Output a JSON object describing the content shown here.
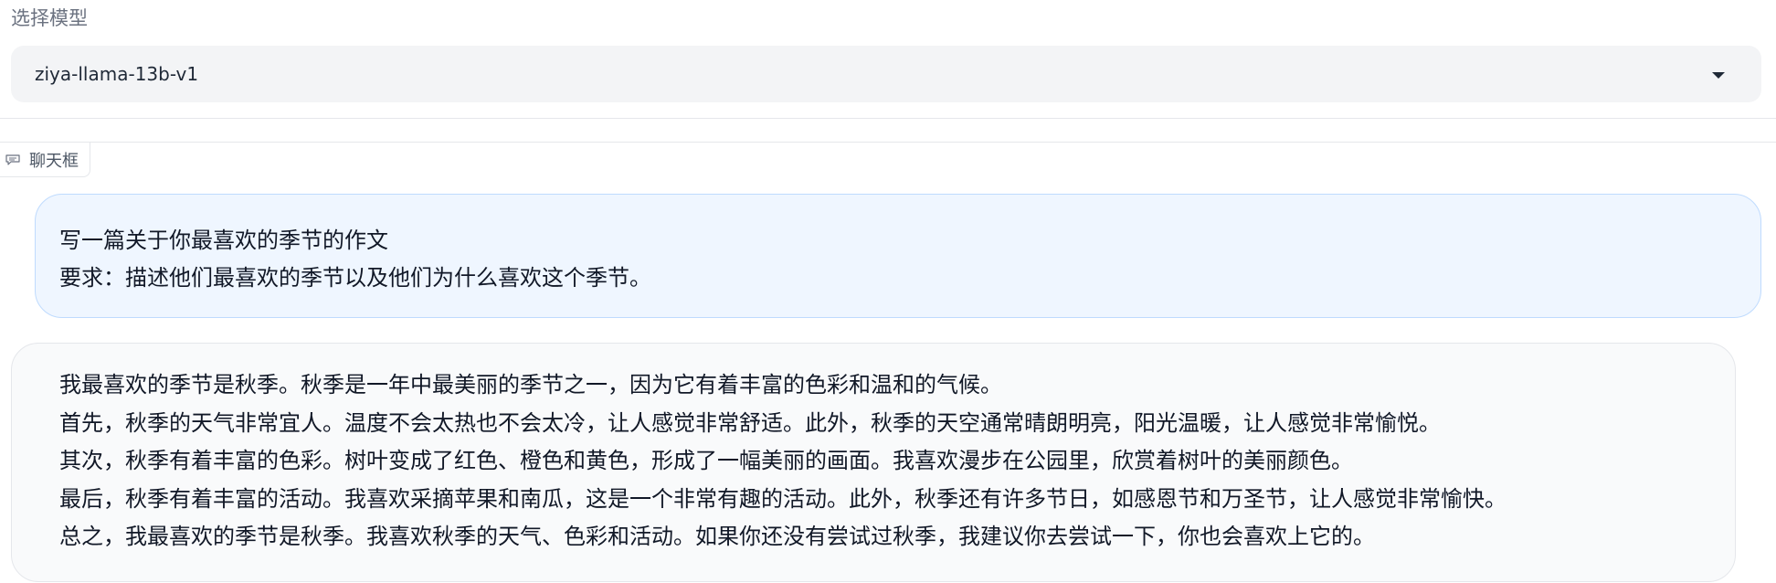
{
  "model_selector": {
    "label": "选择模型",
    "selected_value": "ziya-llama-13b-v1",
    "icon": "chevron-down-icon"
  },
  "chat": {
    "tab_label": "聊天框",
    "tab_icon": "chat-icon",
    "user_message": {
      "lines": [
        "写一篇关于你最喜欢的季节的作文",
        "要求：描述他们最喜欢的季节以及他们为什么喜欢这个季节。"
      ]
    },
    "bot_message": {
      "lines": [
        "我最喜欢的季节是秋季。秋季是一年中最美丽的季节之一，因为它有着丰富的色彩和温和的气候。",
        "首先，秋季的天气非常宜人。温度不会太热也不会太冷，让人感觉非常舒适。此外，秋季的天空通常晴朗明亮，阳光温暖，让人感觉非常愉悦。",
        "其次，秋季有着丰富的色彩。树叶变成了红色、橙色和黄色，形成了一幅美丽的画面。我喜欢漫步在公园里，欣赏着树叶的美丽颜色。",
        "最后，秋季有着丰富的活动。我喜欢采摘苹果和南瓜，这是一个非常有趣的活动。此外，秋季还有许多节日，如感恩节和万圣节，让人感觉非常愉快。",
        "总之，我最喜欢的季节是秋季。我喜欢秋季的天气、色彩和活动。如果你还没有尝试过秋季，我建议你去尝试一下，你也会喜欢上它的。"
      ]
    }
  },
  "colors": {
    "user_bubble_bg": "#eff6ff",
    "user_bubble_border": "#bfdbfe",
    "bot_bubble_bg": "#f9fafb",
    "select_bg": "#f3f4f6"
  }
}
